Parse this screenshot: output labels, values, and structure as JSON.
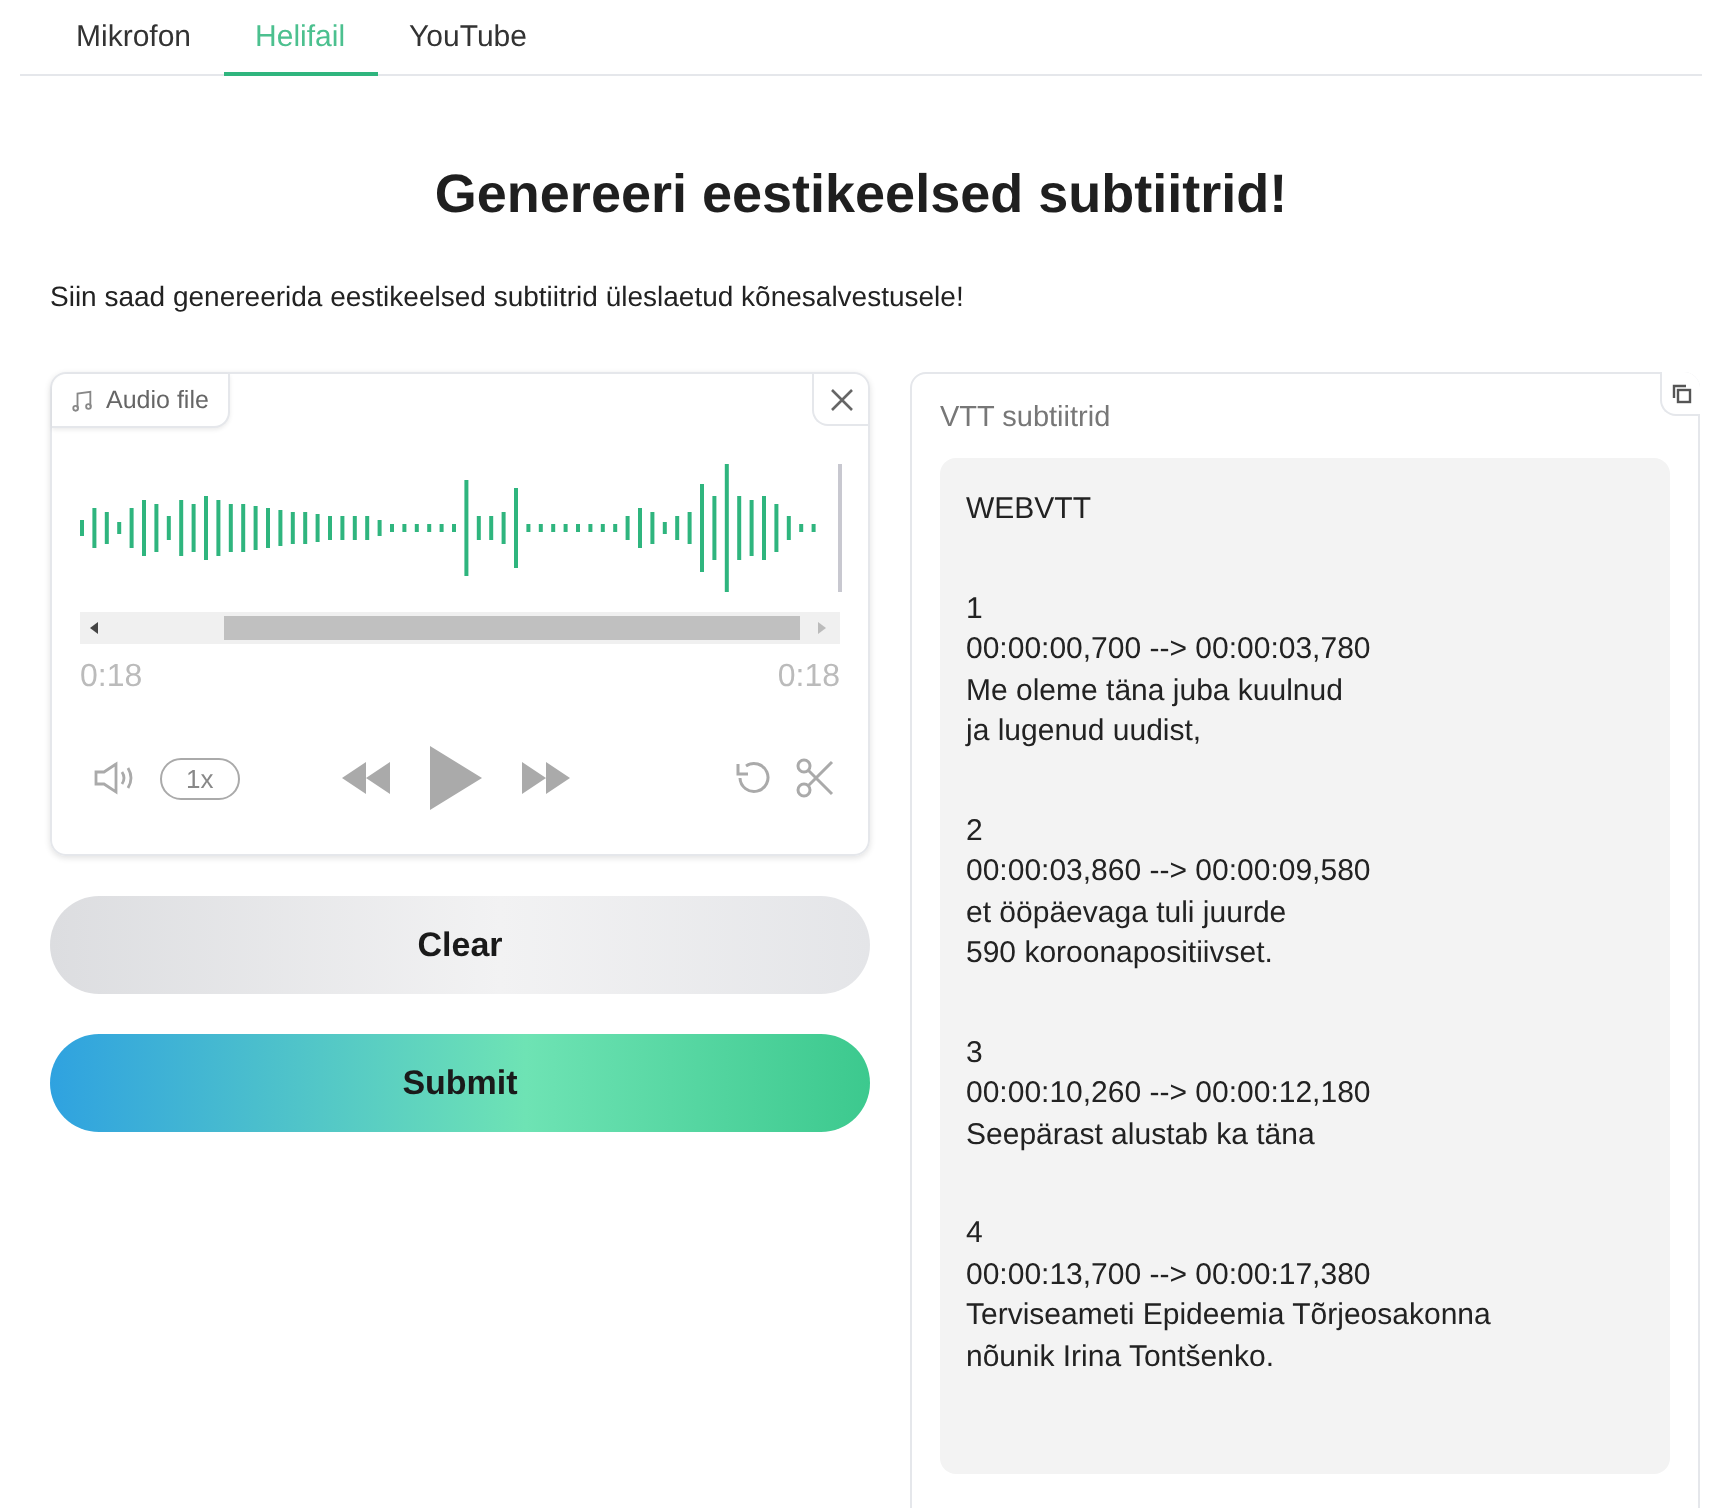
{
  "tabs": [
    {
      "label": "Mikrofon",
      "selected": false
    },
    {
      "label": "Helifail",
      "selected": true
    },
    {
      "label": "YouTube",
      "selected": false
    }
  ],
  "title": "Genereeri eestikeelsed subtiitrid!",
  "description": "Siin saad genereerida eestikeelsed subtiitrid üleslaetud kõnesalvestusele!",
  "audio": {
    "label": "Audio file",
    "time_current": "0:18",
    "time_total": "0:18",
    "speed": "1x"
  },
  "buttons": [
    {
      "label": "Clear",
      "kind": "secondary"
    },
    {
      "label": "Submit",
      "kind": "primary"
    }
  ],
  "output": {
    "label": "VTT subtiitrid",
    "header": "WEBVTT",
    "cues": [
      {
        "index": "1",
        "time": "00:00:00,700 --> 00:00:03,780",
        "lines": [
          "Me oleme täna juba kuulnud",
          "ja lugenud uudist,"
        ]
      },
      {
        "index": "2",
        "time": "00:00:03,860 --> 00:00:09,580",
        "lines": [
          "et ööpäevaga tuli juurde",
          "590 koroonapositiivset."
        ]
      },
      {
        "index": "3",
        "time": "00:00:10,260 --> 00:00:12,180",
        "lines": [
          "Seepärast alustab ka täna"
        ]
      },
      {
        "index": "4",
        "time": "00:00:13,700 --> 00:00:17,380",
        "lines": [
          "Terviseameti Epideemia Tõrjeosakonna",
          "nõunik Irina Tontšenko."
        ]
      }
    ]
  }
}
